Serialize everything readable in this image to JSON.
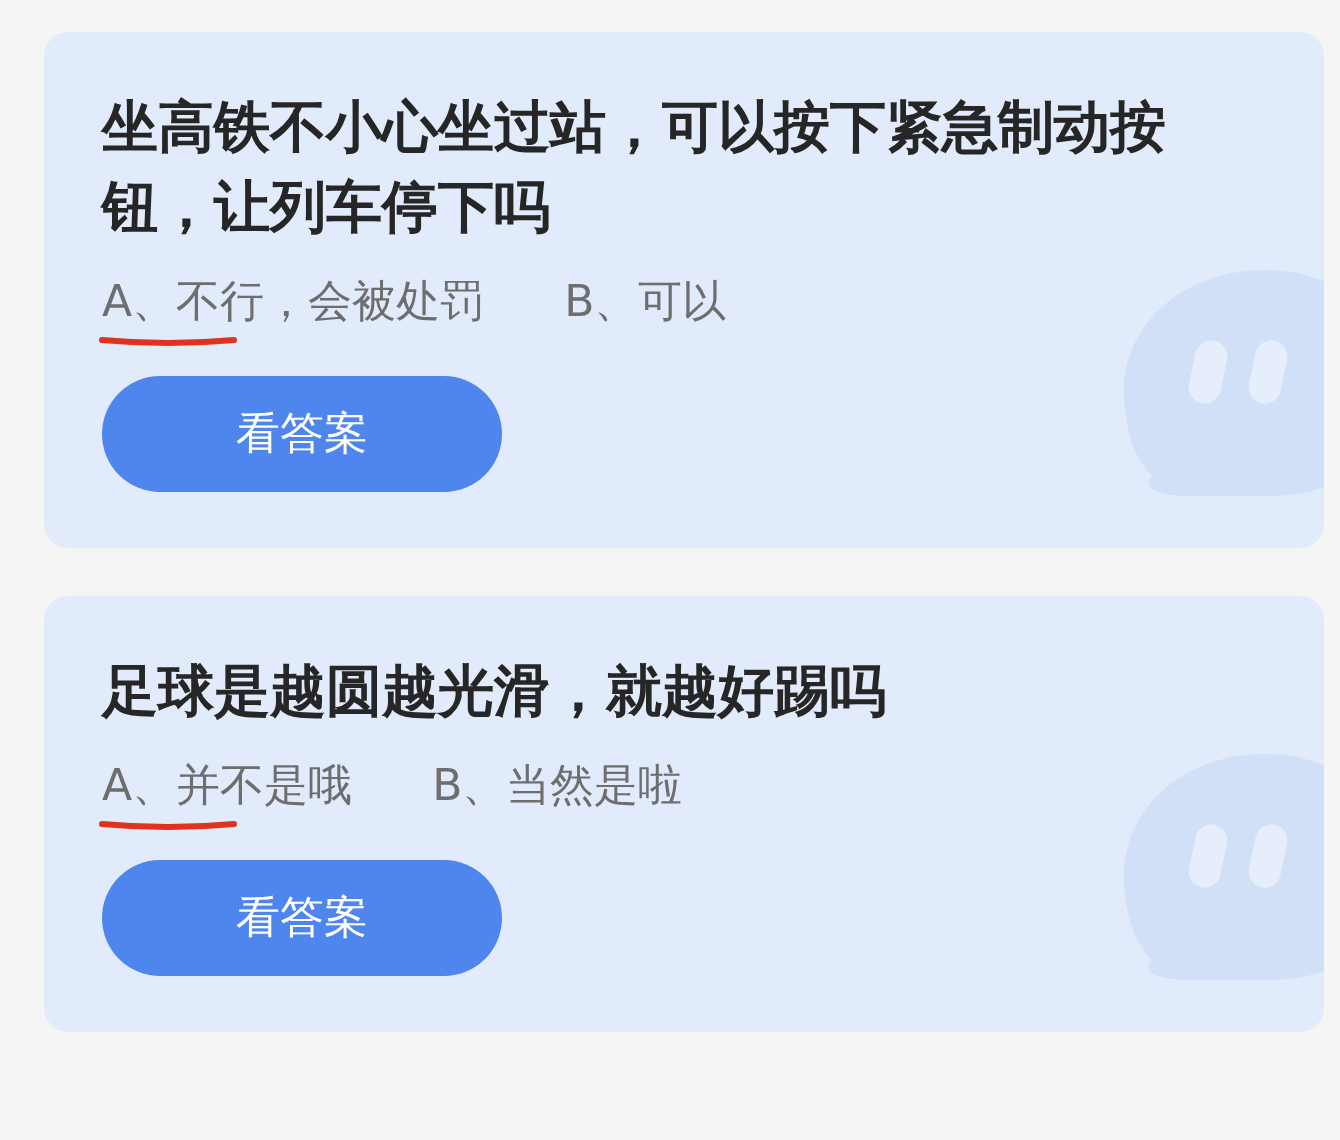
{
  "cards": [
    {
      "question": "坐高铁不小心坐过站，可以按下紧急制动按钮，让列车停下吗",
      "options": [
        {
          "text": "A、不行，会被处罚",
          "marked": true
        },
        {
          "text": "B、可以",
          "marked": false
        }
      ],
      "button": "看答案"
    },
    {
      "question": "足球是越圆越光滑，就越好踢吗",
      "options": [
        {
          "text": "A、并不是哦",
          "marked": true
        },
        {
          "text": "B、当然是啦",
          "marked": false
        }
      ],
      "button": "看答案"
    }
  ]
}
